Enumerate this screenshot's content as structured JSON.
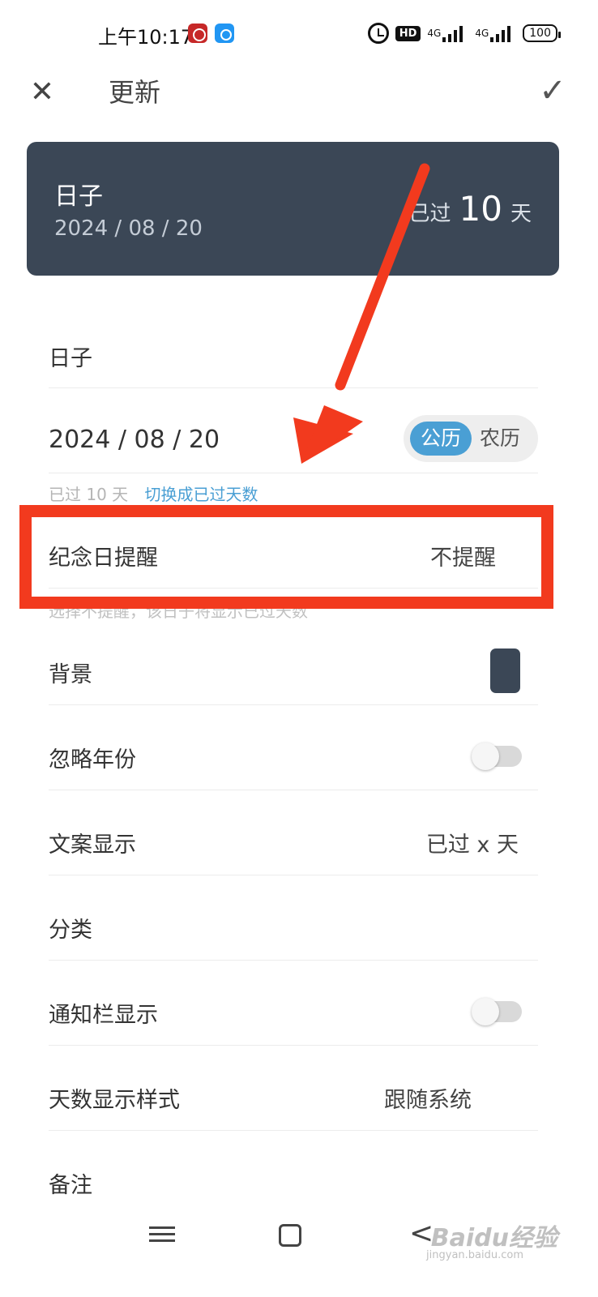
{
  "status_bar": {
    "time": "上午10:17",
    "hd": "HD",
    "net1": "4G",
    "net2": "4G",
    "battery": "100"
  },
  "topbar": {
    "close_glyph": "✕",
    "title": "更新",
    "confirm_glyph": "✓"
  },
  "card": {
    "title": "日子",
    "date": "2024 / 08 / 20",
    "days_label": "已过",
    "days_value": "10",
    "days_unit": "天",
    "background_color": "#3b4756"
  },
  "form": {
    "name_value": "日子",
    "date_value": "2024 / 08 / 20",
    "calendar_solar": "公历",
    "calendar_lunar": "农历",
    "hint_days": "已过 10 天",
    "hint_switch": "切换成已过天数",
    "reminder_label": "纪念日提醒",
    "reminder_value": "不提醒",
    "reminder_hint": "选择不提醒，该日子将显示已过天数",
    "background_label": "背景",
    "ignore_year_label": "忽略年份",
    "ignore_year_on": false,
    "text_display_label": "文案显示",
    "text_display_value": "已过 x 天",
    "category_label": "分类",
    "notification_label": "通知栏显示",
    "notification_on": false,
    "day_style_label": "天数显示样式",
    "day_style_value": "跟随系统",
    "note_label": "备注"
  },
  "nav": {
    "back_glyph": "<"
  },
  "watermark": {
    "brand": "Baidu经验",
    "url": "jingyan.baidu.com"
  },
  "colors": {
    "accent": "#4a9fd4",
    "annotation_red": "#f23a1e",
    "card_bg": "#3b4756"
  }
}
